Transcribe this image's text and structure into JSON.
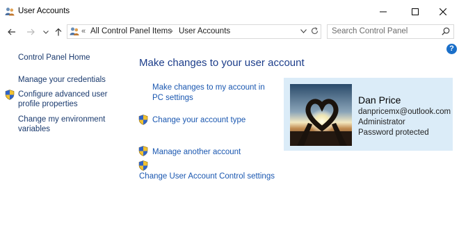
{
  "window": {
    "title": "User Accounts",
    "icon": "user-accounts-icon"
  },
  "navigation": {
    "breadcrumbs": [
      "All Control Panel Items",
      "User Accounts"
    ],
    "search_placeholder": "Search Control Panel"
  },
  "sidebar": {
    "items": [
      {
        "label": "Control Panel Home"
      },
      {
        "label": "Manage your credentials"
      },
      {
        "label": "Configure advanced user profile properties",
        "icon": "shield-icon"
      },
      {
        "label": "Change my environment variables"
      }
    ]
  },
  "main": {
    "heading": "Make changes to your user account",
    "links": [
      {
        "label": "Make changes to my account in PC settings"
      },
      {
        "label": "Change your account type",
        "icon": "shield-icon"
      },
      {
        "label": "Manage another account",
        "icon": "shield-icon"
      },
      {
        "label": "Change User Account Control settings",
        "icon": "shield-icon"
      }
    ]
  },
  "account": {
    "name": "Dan Price",
    "email": "danpricemx@outlook.com",
    "role": "Administrator",
    "status": "Password protected",
    "avatar": "heart-hands-sunset-photo"
  },
  "colors": {
    "link": "#1a57b0",
    "heading": "#1c3d8a",
    "panel_bg": "#dbecf8",
    "help": "#1a6fc9"
  }
}
